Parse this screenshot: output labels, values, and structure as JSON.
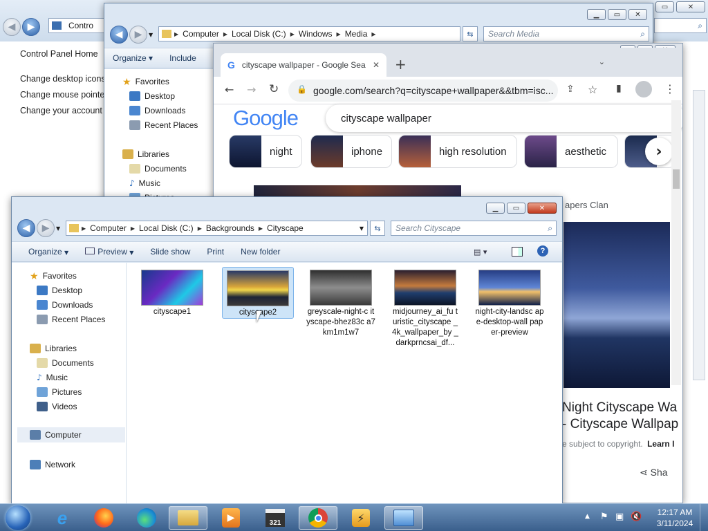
{
  "control_panel": {
    "breadcrumb": "Contro",
    "links": [
      "Control Panel Home",
      "Change desktop icons",
      "Change mouse pointer",
      "Change your account p"
    ]
  },
  "media_explorer": {
    "breadcrumb": [
      "Computer",
      "Local Disk (C:)",
      "Windows",
      "Media"
    ],
    "search_placeholder": "Search Media",
    "toolbar": [
      "Organize ▾",
      "Include"
    ],
    "nav": [
      "Favorites",
      "Desktop",
      "Downloads",
      "Recent Places",
      "Libraries",
      "Documents",
      "Music",
      "Pictures"
    ]
  },
  "chrome": {
    "tab_title": "cityscape wallpaper - Google Sea",
    "url": "google.com/search?q=cityscape+wallpaper&&tbm=isc...",
    "logo": "Google",
    "query": "cityscape wallpaper",
    "chips": [
      "night",
      "iphone",
      "high resolution",
      "aesthetic"
    ],
    "result_source": "apers Clan",
    "result_title_1": "Night Cityscape Wa",
    "result_title_2": "- Cityscape Wallpap",
    "copyright_text": "e subject to copyright.",
    "learn_more": "Learn I",
    "share": "Sha"
  },
  "city_explorer": {
    "breadcrumb": [
      "Computer",
      "Local Disk (C:)",
      "Backgrounds",
      "Cityscape"
    ],
    "search_placeholder": "Search Cityscape",
    "toolbar": {
      "organize": "Organize",
      "preview": "Preview",
      "slideshow": "Slide show",
      "print": "Print",
      "new_folder": "New folder"
    },
    "nav": {
      "favorites": "Favorites",
      "desktop": "Desktop",
      "downloads": "Downloads",
      "recent": "Recent Places",
      "libraries": "Libraries",
      "documents": "Documents",
      "music": "Music",
      "pictures": "Pictures",
      "videos": "Videos",
      "computer": "Computer",
      "network": "Network"
    },
    "files": [
      {
        "name": "cityscape1"
      },
      {
        "name": "cityscape2"
      },
      {
        "name": "greyscale-night-c ityscape-bhez83c a7km1m1w7"
      },
      {
        "name": "midjourney_ai_fu turistic_cityscape _4k_wallpaper_by _darkprncsai_df..."
      },
      {
        "name": "night-city-landsc ape-desktop-wall paper-preview"
      }
    ]
  },
  "taskbar": {
    "time": "12:17 AM",
    "date": "3/11/2024",
    "apps": [
      "start-orb",
      "internet-explorer",
      "firefox",
      "edge",
      "file-explorer",
      "media-player",
      "clapper",
      "chrome",
      "bolt",
      "control-panel"
    ]
  }
}
